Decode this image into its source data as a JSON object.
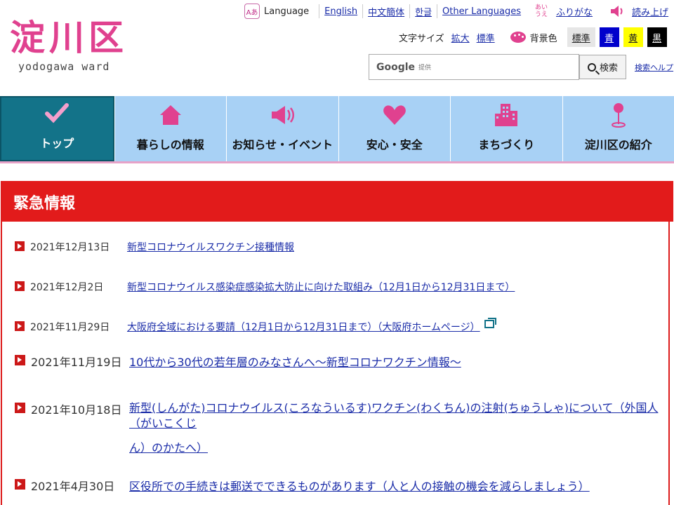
{
  "site": {
    "logo_kanji": "淀川区",
    "logo_roman": "yodogawa ward"
  },
  "topbar": {
    "language_label": "Language",
    "language_icon_text": "Aあ",
    "english": "English",
    "chinese": "中文簡体",
    "korean": "한글",
    "other": "Other Languages",
    "furigana_icon_text": "あいうえ",
    "furigana": "ふりがな",
    "read_aloud": "読み上げ"
  },
  "text_size": {
    "label": "文字サイズ",
    "enlarge": "拡大",
    "standard": "標準"
  },
  "background": {
    "label": "背景色",
    "options": [
      {
        "label": "標準",
        "bg": "#e6e6e6",
        "fg": "#222222"
      },
      {
        "label": "青",
        "bg": "#0000cc",
        "fg": "#ffffff"
      },
      {
        "label": "黄",
        "bg": "#ffff00",
        "fg": "#222222"
      },
      {
        "label": "黒",
        "bg": "#000000",
        "fg": "#ffffff"
      }
    ]
  },
  "search": {
    "google_label": "Google",
    "powered_label": "提供",
    "button": "検索",
    "help": "検索ヘルプ"
  },
  "nav": {
    "items": [
      {
        "label": "トップ",
        "icon": "check-icon"
      },
      {
        "label": "暮らしの情報",
        "icon": "house-icon"
      },
      {
        "label": "お知らせ・イベント",
        "icon": "megaphone-icon"
      },
      {
        "label": "安心・安全",
        "icon": "heart-icon"
      },
      {
        "label": "まちづくり",
        "icon": "buildings-icon"
      },
      {
        "label": "淀川区の紹介",
        "icon": "map-pin-icon"
      }
    ]
  },
  "emergency": {
    "title": "緊急情報",
    "items": [
      {
        "date": "2021年12月13日",
        "text": "新型コロナウイルスワクチン接種情報"
      },
      {
        "date": "2021年12月2日",
        "text": "新型コロナウイルス感染症感染拡大防止に向けた取組み（12月1日から12月31日まで）"
      },
      {
        "date": "2021年11月29日",
        "text": "大阪府全域における要請（12月1日から12月31日まで）（大阪府ホームページ）"
      },
      {
        "date": "2021年11月19日",
        "text": "10代から30代の若年層のみなさんへ～新型コロナワクチン情報～"
      },
      {
        "date": "2021年10月18日",
        "text_line1": "新型(しんがた)コロナウイルス(ころなういるす)ワクチン(わくちん)の注射(ちゅうしゃ)について（外国人（がいこくじ",
        "text_line2": "ん）のかたへ）"
      },
      {
        "date": "2021年4月30日",
        "text": "区役所での手続きは郵送でできるものがあります（人と人の接触の機会を減らしましょう）"
      }
    ]
  },
  "colors": {
    "brand_pink": "#e0418f",
    "nav_blue": "#a8d1f5",
    "nav_active": "#137389",
    "emergency_red": "#e21b1b",
    "link": "#1a2ca8"
  }
}
